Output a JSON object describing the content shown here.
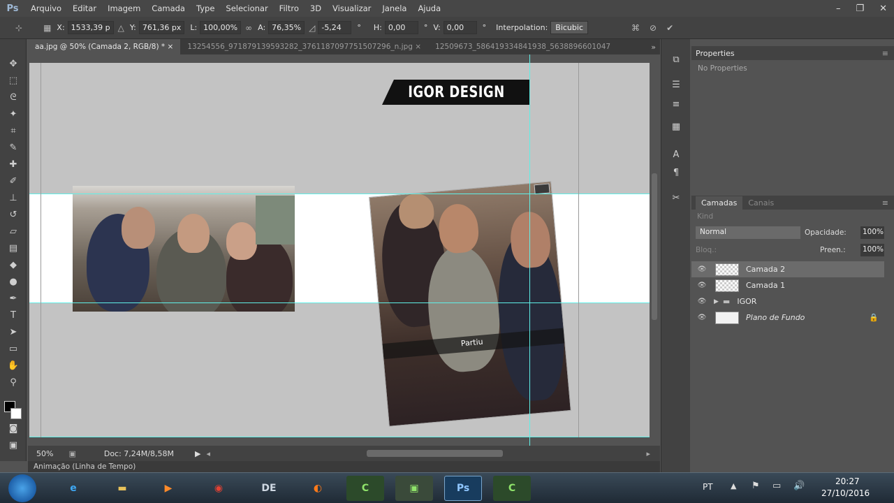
{
  "app": {
    "logo": "Ps"
  },
  "menu": [
    "Arquivo",
    "Editar",
    "Imagem",
    "Camada",
    "Type",
    "Selecionar",
    "Filtro",
    "3D",
    "Visualizar",
    "Janela",
    "Ajuda"
  ],
  "window_controls": {
    "minimize": "–",
    "restore": "❐",
    "close": "✕"
  },
  "options": {
    "x_label": "X:",
    "x_value": "1533,39 p",
    "y_label": "Y:",
    "y_value": "761,36 px",
    "w_label": "L:",
    "w_value": "100,00%",
    "h_label": "A:",
    "h_value": "76,35%",
    "angle_value": "-5,24",
    "angle_unit": "°",
    "hskew_label": "H:",
    "hskew_value": "0,00",
    "hskew_unit": "°",
    "vskew_label": "V:",
    "vskew_value": "0,00",
    "vskew_unit": "°",
    "interp_label": "Interpolation:",
    "interp_value": "Bicubic"
  },
  "tabs": [
    "aa.jpg @ 50% (Camada 2, RGB/8) *",
    "13254556_971879139593282_3761187097751507296_n.jpg",
    "12509673_586419334841938_5638896601047"
  ],
  "tab_close": "×",
  "canvas": {
    "logo_text": "IGOR DESIGN",
    "photo_caption": "Partiu"
  },
  "status": {
    "zoom": "50%",
    "doc": "Doc: 7,24M/8,58M"
  },
  "timeline_label": "Animação (Linha de Tempo)",
  "properties": {
    "title": "Properties",
    "empty_text": "No Properties"
  },
  "layers_panel": {
    "tab_layers": "Camadas",
    "tab_channels": "Canais",
    "filter_kind": "Kind",
    "blend_mode": "Normal",
    "opacity_label": "Opacidade:",
    "opacity_value": "100%",
    "lock_label": "Bloq.:",
    "fill_label": "Preen.:",
    "fill_value": "100%",
    "layers": [
      {
        "name": "Camada 2",
        "selected": true
      },
      {
        "name": "Camada 1",
        "selected": false
      },
      {
        "name": "IGOR",
        "selected": false,
        "group": true
      },
      {
        "name": "Plano de Fundo",
        "selected": false,
        "locked": true
      }
    ]
  },
  "taskbar": {
    "language": "PT",
    "time": "20:27",
    "date": "27/10/2016"
  }
}
